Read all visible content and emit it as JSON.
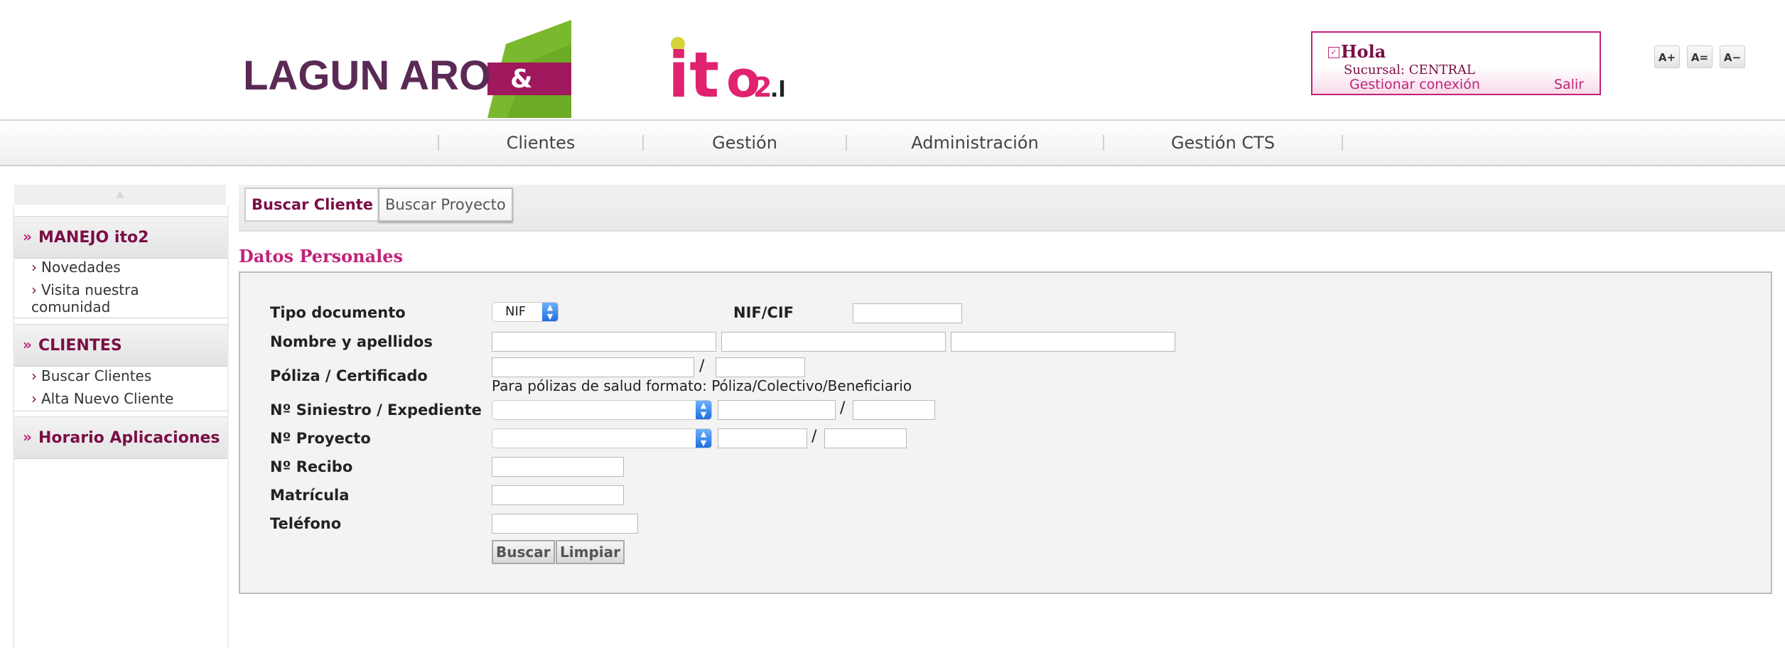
{
  "header": {
    "logo_lagun_text": "LAGUN ARO",
    "logo_ito2_text": "ito2",
    "user": {
      "greeting": "Hola",
      "branch": "Sucursal: CENTRAL",
      "manage_link": "Gestionar conexión",
      "logout_link": "Salir"
    },
    "font_controls": [
      "A+",
      "A=",
      "A−"
    ]
  },
  "nav": {
    "items": [
      "Clientes",
      "Gestión",
      "Administración",
      "Gestión CTS"
    ]
  },
  "sidebar": {
    "sections": [
      {
        "title": "MANEJO ito2",
        "items": [
          "Novedades",
          "Visita nuestra comunidad"
        ]
      },
      {
        "title": "CLIENTES",
        "items": [
          "Buscar Clientes",
          "Alta Nuevo Cliente"
        ]
      },
      {
        "title": "Horario Aplicaciones",
        "items": []
      }
    ]
  },
  "tabs": [
    "Buscar Cliente",
    "Buscar Proyecto"
  ],
  "form": {
    "section_title": "Datos Personales",
    "labels": {
      "tipo_documento": "Tipo documento",
      "nif_cif": "NIF/CIF",
      "nombre": "Nombre y apellidos",
      "poliza": "Póliza / Certificado",
      "siniestro": "Nº Siniestro / Expediente",
      "proyecto": "Nº Proyecto",
      "recibo": "Nº Recibo",
      "matricula": "Matrícula",
      "telefono": "Teléfono"
    },
    "tipo_documento_value": "NIF",
    "poliza_hint": "Para pólizas de salud formato: Póliza/Colectivo/Beneficiario",
    "separator": "/",
    "buttons": {
      "buscar": "Buscar",
      "limpiar": "Limpiar"
    }
  },
  "colors": {
    "brand_magenta": "#c0237a",
    "brand_dark": "#7a0f45",
    "logo_green": "#7ab82e"
  }
}
